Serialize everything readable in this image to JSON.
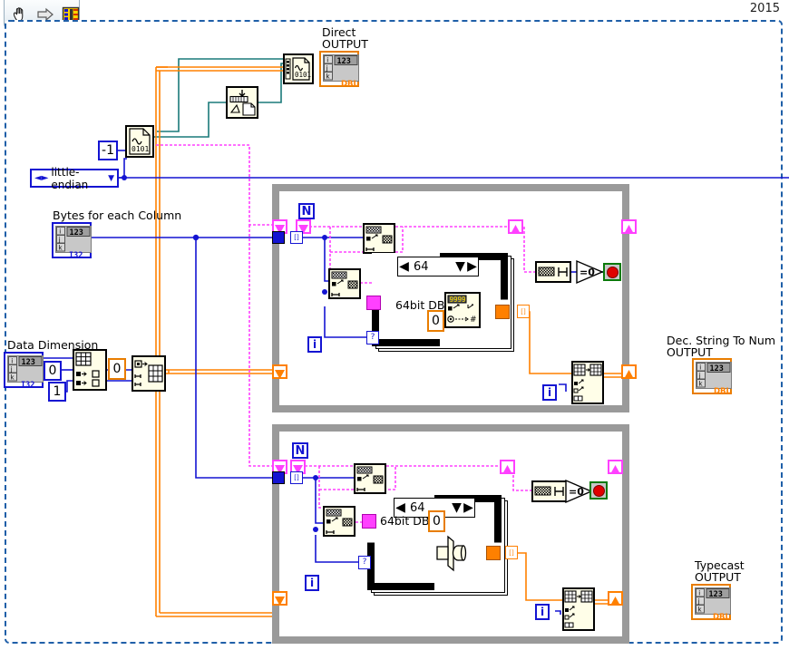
{
  "window": {
    "version_badge": "2015",
    "toolbar": {
      "buttons": [
        {
          "name": "hand-tool",
          "icon": "hand-icon"
        },
        {
          "name": "run-arrow",
          "icon": "arrow-right-icon"
        },
        {
          "name": "connector-pane",
          "icon": "connector-pane-icon"
        }
      ]
    }
  },
  "labels": {
    "direct_output": "Direct\nOUTPUT",
    "dec_string_output": "Dec. String To Num\nOUTPUT",
    "typecast_output": "Typecast\nOUTPUT",
    "bytes_for_each_column": "Bytes for each Column",
    "data_dimension": "Data Dimension",
    "bits_upper": "64bit DBL",
    "bits_lower": "64bit DBL"
  },
  "constants": {
    "neg_one": "-1",
    "endianness": "little-endian",
    "index_zero": "0",
    "index_one": "1",
    "init_zero": "0",
    "offset_upper": "0",
    "offset_lower": "0",
    "bit_count_upper": "64",
    "bit_count_lower": "64",
    "compare_zero": "0"
  },
  "terminals": {
    "direct_output": {
      "type": "DBL",
      "rep": "123",
      "dims": [
        "i",
        "j",
        "k"
      ]
    },
    "bytes_for_each_column": {
      "type": "I32",
      "rep": "123",
      "dims": [
        "i",
        "j",
        "k"
      ]
    },
    "data_dimension": {
      "type": "I32",
      "rep": "123",
      "dims": [
        "i",
        "j",
        "k"
      ]
    },
    "dec_string_output": {
      "type": "DBL",
      "rep": "123",
      "dims": [
        "i",
        "j",
        "k"
      ]
    },
    "typecast_output": {
      "type": "DBL",
      "rep": "123",
      "dims": [
        "i",
        "j",
        "k"
      ]
    }
  },
  "structures": {
    "upper_loop": {
      "name": "for-loop-upper",
      "count_label": "N",
      "iterator_label": "i"
    },
    "lower_loop": {
      "name": "for-loop-lower",
      "count_label": "N",
      "iterator_label": "i"
    },
    "upper_case": {
      "selector": "64",
      "label": "64bit DBL"
    },
    "lower_case": {
      "selector": "64",
      "label": "64bit DBL"
    }
  },
  "nodes": [
    {
      "name": "read-from-binary-file-top",
      "icon": "binary-file-icon",
      "glyph": "0101"
    },
    {
      "name": "close-file",
      "icon": "close-file-icon"
    },
    {
      "name": "read-from-binary-file-left",
      "icon": "binary-file-icon",
      "glyph": "0101"
    },
    {
      "name": "index-array",
      "icon": "index-array-icon"
    },
    {
      "name": "initialize-array",
      "icon": "initialize-array-icon"
    },
    {
      "name": "string-subset-upper-1",
      "icon": "string-subset-icon"
    },
    {
      "name": "string-subset-upper-2",
      "icon": "string-subset-icon"
    },
    {
      "name": "decimal-string-to-number",
      "icon": "dec-string-to-number-icon",
      "glyph": "999"
    },
    {
      "name": "string-length-upper",
      "icon": "string-length-icon"
    },
    {
      "name": "equal-zero-upper",
      "icon": "equal-to-zero-icon",
      "glyph": "=0"
    },
    {
      "name": "replace-array-subset-upper",
      "icon": "replace-array-subset-icon"
    },
    {
      "name": "string-subset-lower-1",
      "icon": "string-subset-icon"
    },
    {
      "name": "string-subset-lower-2",
      "icon": "string-subset-icon"
    },
    {
      "name": "typecast",
      "icon": "typecast-icon"
    },
    {
      "name": "string-length-lower",
      "icon": "string-length-icon"
    },
    {
      "name": "equal-zero-lower",
      "icon": "equal-to-zero-icon",
      "glyph": "=0"
    },
    {
      "name": "replace-array-subset-lower",
      "icon": "replace-array-subset-icon"
    }
  ],
  "colors": {
    "wire_blue": "#1414d2",
    "wire_orange": "#ff8000",
    "wire_pink": "#ff40ff",
    "wire_teal": "#1a7a7a",
    "node_fill": "#fffee8",
    "loop_gray": "#9a9a9a",
    "frame_blue": "#1f5fa8"
  }
}
